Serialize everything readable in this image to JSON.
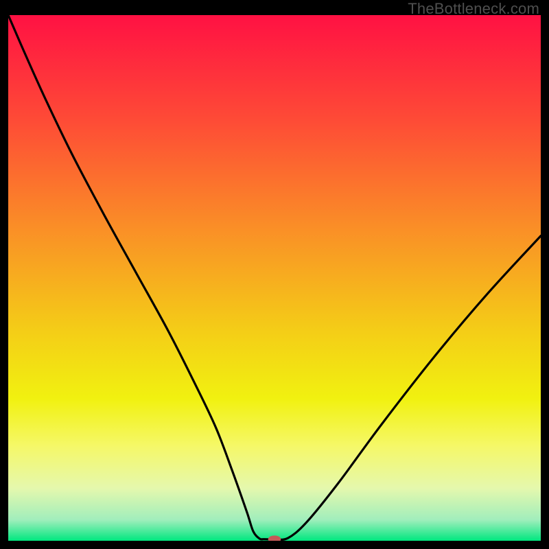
{
  "watermark": "TheBottleneck.com",
  "chart_data": {
    "type": "line",
    "title": "",
    "xlabel": "",
    "ylabel": "",
    "xlim": [
      0,
      100
    ],
    "ylim": [
      0,
      100
    ],
    "grid": false,
    "legend": false,
    "background_gradient": {
      "stops": [
        {
          "offset": 0.0,
          "color": "#ff1143"
        },
        {
          "offset": 0.2,
          "color": "#fe4b36"
        },
        {
          "offset": 0.4,
          "color": "#fa8d27"
        },
        {
          "offset": 0.6,
          "color": "#f4cd17"
        },
        {
          "offset": 0.73,
          "color": "#f1f110"
        },
        {
          "offset": 0.82,
          "color": "#f5f868"
        },
        {
          "offset": 0.9,
          "color": "#e5f8ad"
        },
        {
          "offset": 0.96,
          "color": "#a1eebc"
        },
        {
          "offset": 1.0,
          "color": "#00e77f"
        }
      ]
    },
    "series": [
      {
        "name": "bottleneck-curve",
        "x": [
          0.0,
          3.0,
          7.0,
          12.0,
          18.0,
          24.0,
          30.0,
          35.0,
          39.0,
          42.0,
          44.8,
          46.0,
          47.2,
          48.0,
          50.0,
          52.5,
          56.0,
          62.0,
          70.0,
          80.0,
          90.0,
          100.0
        ],
        "y": [
          100.0,
          93.0,
          84.0,
          73.5,
          62.0,
          51.0,
          40.0,
          30.0,
          21.5,
          13.5,
          5.5,
          1.8,
          0.4,
          0.3,
          0.3,
          0.5,
          3.5,
          11.0,
          22.0,
          35.0,
          47.0,
          58.0
        ]
      }
    ],
    "marker": {
      "name": "optimal-point",
      "x": 50.0,
      "y": 0.3,
      "color": "#c45a58",
      "rx": 1.2,
      "ry": 0.7
    }
  }
}
